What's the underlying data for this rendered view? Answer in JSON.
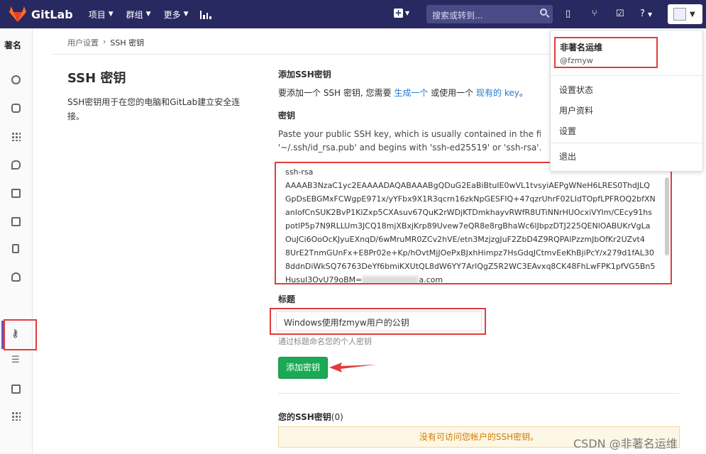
{
  "topbar": {
    "brand": "GitLab",
    "nav": [
      {
        "label": "项目"
      },
      {
        "label": "群组"
      },
      {
        "label": "更多"
      }
    ],
    "search_placeholder": "搜索或转到..."
  },
  "sidebar": {
    "top_label": "著名",
    "active_item": "ssh-keys"
  },
  "breadcrumb": {
    "parent": "用户设置",
    "current": "SSH 密钥"
  },
  "page": {
    "title": "SSH 密钥",
    "description": "SSH密钥用于在您的电脑和GitLab建立安全连接。"
  },
  "add_section": {
    "heading": "添加SSH密钥",
    "desc_prefix": "要添加一个 SSH 密钥, 您需要 ",
    "link_generate": "生成一个",
    "desc_mid": " 或使用一个 ",
    "link_existing": "现有的 key",
    "desc_suffix": "。",
    "key_label": "密钥",
    "help_line1": "Paste your public SSH key, which is usually contained in the file '~/.ss",
    "help_line2": "'~/.ssh/id_rsa.pub' and begins with 'ssh-ed25519' or 'ssh-rsa'. Don't u",
    "key_lines": [
      "ssh-rsa",
      "AAAAB3NzaC1yc2EAAAADAQABAAABgQDuG2EaBiBtuIE0wVL1tvsyiAEPgWNeH6LRES0ThdJLQ",
      "GpDsEBGMxFCWgpE971x/yYFbx9X1R3qcrn16zkNpGESFIQ+47qzrUhrF02LIdTOpfLPFROQ2bfXN",
      "anIofCnSUK2BvP1KlZxp5CXAsuv67QuK2rWDjKTDmkhayvRWfR8UTiNNrHUOcxiVYIm/CEcy91hs",
      "potlP5p7N9RLLUm3JCQ18mjXBxjKrp89Uvew7eQR8e8rgBhaWc6lJbpzDTJ225QENlOABUKrVgLa",
      "OuJCi6OoOcKJyuEXnqD/6wMruMR0ZCv2hVE/etn3MzjzgJuF2ZbD4Z9RQPAlPzzmJbOfKr2UZvt4",
      "8UrE2TnmGUnFx+E8Pr02e+Kp/hOvtMjJOePxBJxhHimpz7HsGdqJCtmvEeKhBjiPcY/x279d1fAL30",
      "8ddnDiWkSQ76763DeYf6bmiKXUtQL8dW6YY7ArlQgZ5R2WC3EAvxq8CK48FhLwFPK1pfVG5Bn5"
    ],
    "key_last_prefix": "HusuI3OvU79oBM=",
    "key_last_suffix": "a.com",
    "title_label": "标题",
    "title_value": "Windows使用fzmyw用户的公钥",
    "title_help": "通过标题命名您的个人密钥",
    "add_button": "添加密钥"
  },
  "your_keys": {
    "heading": "您的SSH密钥",
    "count": "(0)",
    "empty_message": "没有可访问您帐户的SSH密钥。"
  },
  "user_menu": {
    "name": "非著名运维",
    "handle": "@fzmyw",
    "items": [
      {
        "label": "设置状态"
      },
      {
        "label": "用户资料"
      },
      {
        "label": "设置"
      },
      {
        "label": "退出"
      }
    ]
  },
  "watermark": "CSDN @非著名运维",
  "colors": {
    "topbar": "#292961",
    "accent_button": "#1aaa55",
    "highlight_box": "#e03c3c",
    "link": "#1f78d1"
  }
}
